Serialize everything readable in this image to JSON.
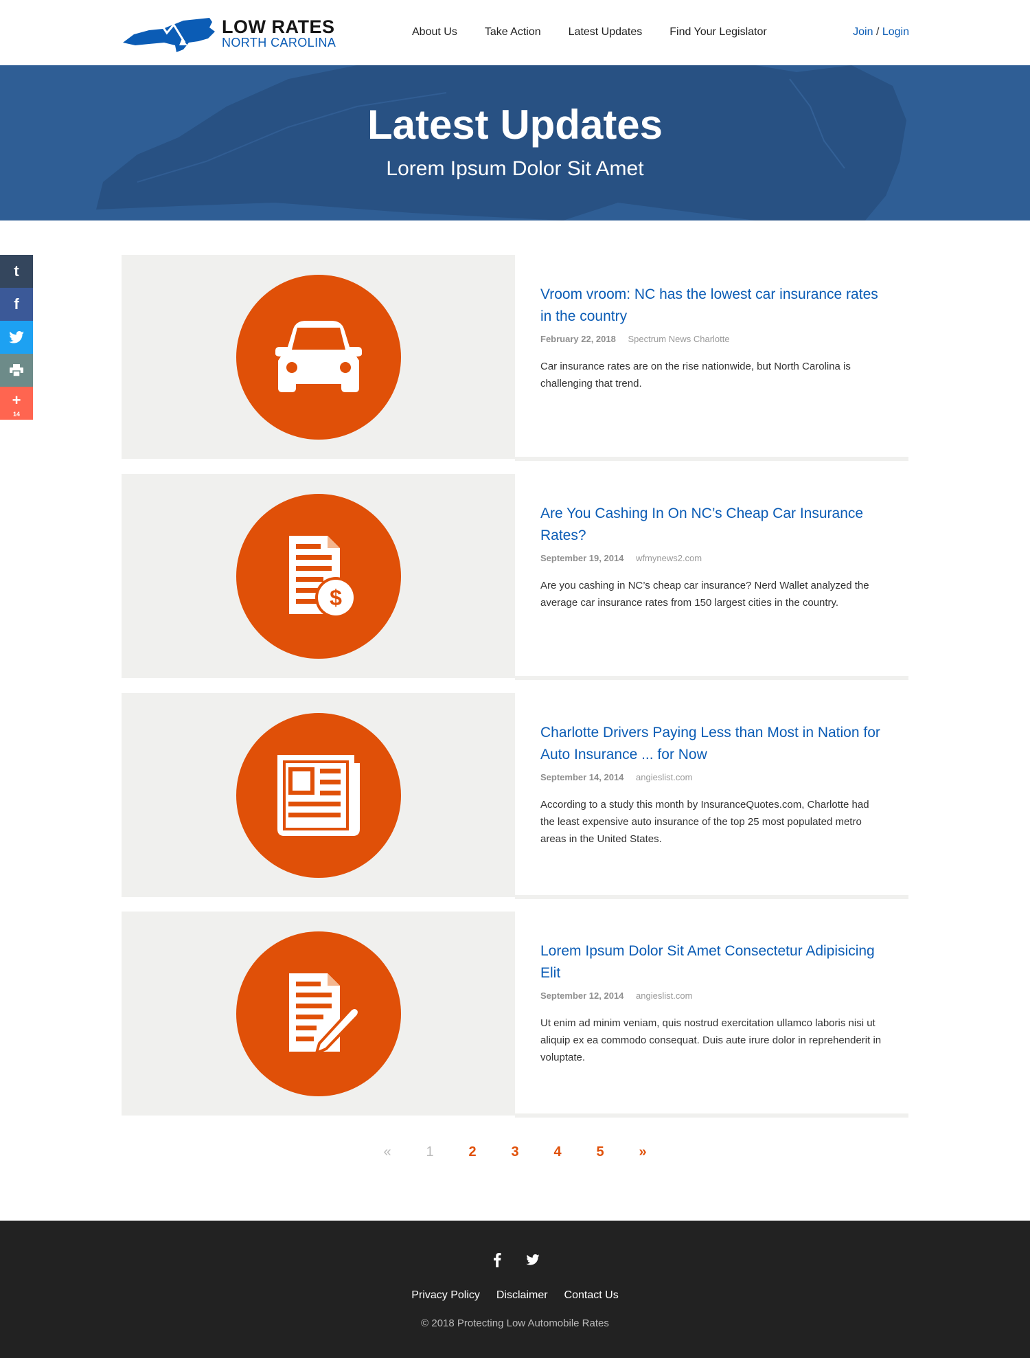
{
  "header": {
    "logo_line1": "LOW RATES",
    "logo_line2": "NORTH CAROLINA",
    "nav": [
      {
        "label": "About Us"
      },
      {
        "label": "Take Action"
      },
      {
        "label": "Latest Updates"
      },
      {
        "label": "Find Your Legislator"
      }
    ],
    "join_label": "Join",
    "separator": "/",
    "login_label": "Login"
  },
  "hero": {
    "title": "Latest Updates",
    "subtitle": "Lorem Ipsum Dolor Sit Amet"
  },
  "share_bar": {
    "buttons": [
      {
        "icon": "tumblr-icon",
        "glyph": "t",
        "color": "#34465d"
      },
      {
        "icon": "facebook-icon",
        "glyph": "f",
        "color": "#3b5998"
      },
      {
        "icon": "twitter-icon",
        "glyph": "",
        "color": "#1da1f2"
      },
      {
        "icon": "print-icon",
        "glyph": "",
        "color": "#6d8b89"
      },
      {
        "icon": "more-icon",
        "glyph": "+",
        "color": "#ff6550"
      }
    ],
    "share_count": "14"
  },
  "articles": [
    {
      "icon": "car-icon",
      "title": "Vroom vroom: NC has the lowest car insurance rates in the country",
      "date": "February 22, 2018",
      "source": "Spectrum News Charlotte",
      "excerpt": "Car insurance rates are on the rise nationwide, but North Carolina is challenging that trend."
    },
    {
      "icon": "invoice-dollar-icon",
      "title": "Are You Cashing In On NC’s Cheap Car Insurance Rates?",
      "date": "September 19, 2014",
      "source": "wfmynews2.com",
      "excerpt": "Are you cashing in NC’s cheap car insurance? Nerd Wallet analyzed the average car insurance rates from 150 largest cities in the country."
    },
    {
      "icon": "newspaper-icon",
      "title": "Charlotte Drivers Paying Less than Most in Nation for Auto Insurance ... for Now",
      "date": "September 14, 2014",
      "source": "angieslist.com",
      "excerpt": "According to a study this month by InsuranceQuotes.com, Charlotte had the least expensive auto insurance of the top 25 most populated metro areas in the United States."
    },
    {
      "icon": "document-pen-icon",
      "title": "Lorem Ipsum Dolor Sit Amet Consectetur Adipisicing Elit",
      "date": "September 12, 2014",
      "source": "angieslist.com",
      "excerpt": "Ut enim ad minim veniam, quis nostrud exercitation ullamco laboris nisi ut aliquip ex ea commodo consequat. Duis aute irure dolor in reprehenderit in voluptate."
    }
  ],
  "pagination": {
    "prev": "«",
    "pages": [
      "1",
      "2",
      "3",
      "4",
      "5"
    ],
    "current_page": "1",
    "next": "»"
  },
  "footer": {
    "social": [
      {
        "icon": "facebook-icon"
      },
      {
        "icon": "twitter-icon"
      }
    ],
    "links": [
      {
        "label": "Privacy Policy"
      },
      {
        "label": "Disclaimer"
      },
      {
        "label": "Contact Us"
      }
    ],
    "copyright": "© 2018 Protecting Low Automobile Rates"
  },
  "colors": {
    "accent_blue": "#0b5cb5",
    "accent_orange": "#e05008",
    "hero_blue": "#2f5e95",
    "footer_bg": "#222222"
  }
}
